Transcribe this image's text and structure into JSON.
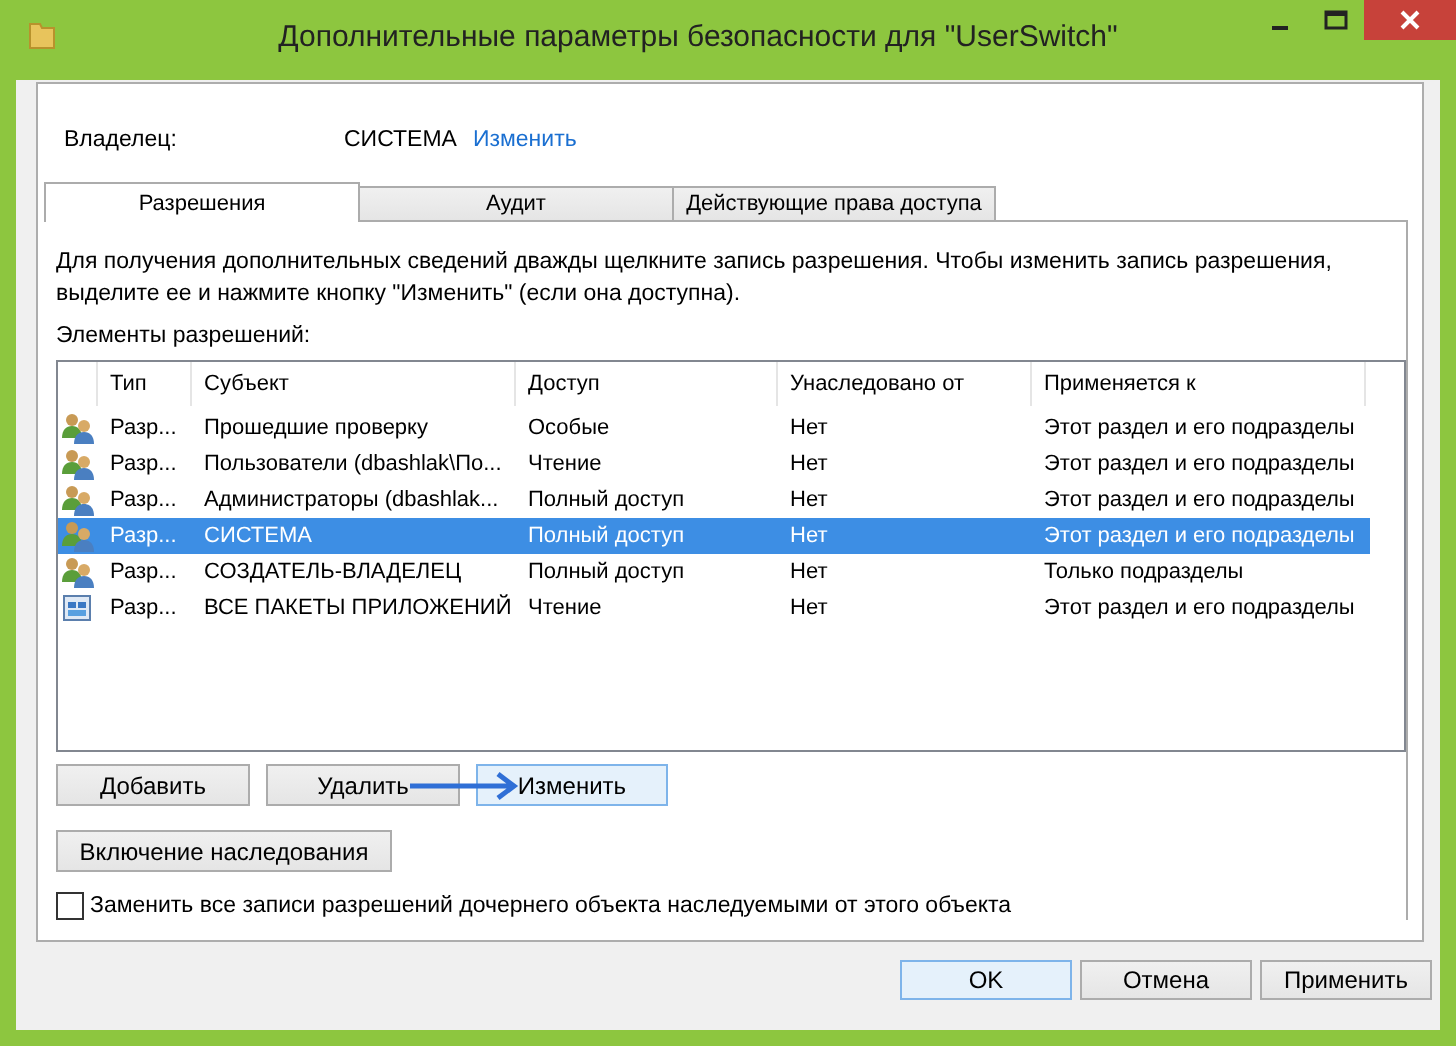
{
  "window": {
    "title": "Дополнительные параметры безопасности  для \"UserSwitch\""
  },
  "owner": {
    "label": "Владелец:",
    "value": "СИСТЕМА",
    "link": "Изменить"
  },
  "tabs": [
    {
      "label": "Разрешения",
      "selected": true
    },
    {
      "label": "Аудит",
      "selected": false
    },
    {
      "label": "Действующие права доступа",
      "selected": false
    }
  ],
  "info": "Для получения дополнительных сведений дважды щелкните запись разрешения. Чтобы изменить запись разрешения, выделите ее и нажмите кнопку \"Изменить\" (если она доступна).",
  "list_label": "Элементы разрешений:",
  "table": {
    "columns": [
      "Тип",
      "Субъект",
      "Доступ",
      "Унаследовано от",
      "Применяется к"
    ],
    "rows": [
      {
        "kind": "group",
        "selected": false,
        "cells": [
          "Разр...",
          "Прошедшие проверку",
          "Особые",
          "Нет",
          "Этот раздел и его подразделы"
        ]
      },
      {
        "kind": "group",
        "selected": false,
        "cells": [
          "Разр...",
          "Пользователи (dbashlak\\По...",
          "Чтение",
          "Нет",
          "Этот раздел и его подразделы"
        ]
      },
      {
        "kind": "group",
        "selected": false,
        "cells": [
          "Разр...",
          "Администраторы (dbashlak...",
          "Полный доступ",
          "Нет",
          "Этот раздел и его подразделы"
        ]
      },
      {
        "kind": "group",
        "selected": true,
        "cells": [
          "Разр...",
          "СИСТЕМА",
          "Полный доступ",
          "Нет",
          "Этот раздел и его подразделы"
        ]
      },
      {
        "kind": "group",
        "selected": false,
        "cells": [
          "Разр...",
          "СОЗДАТЕЛЬ-ВЛАДЕЛЕЦ",
          "Полный доступ",
          "Нет",
          "Только подразделы"
        ]
      },
      {
        "kind": "package",
        "selected": false,
        "cells": [
          "Разр...",
          "ВСЕ ПАКЕТЫ ПРИЛОЖЕНИЙ",
          "Чтение",
          "Нет",
          "Этот раздел и его подразделы"
        ]
      }
    ]
  },
  "entry_buttons": [
    {
      "label": "Добавить",
      "focused": false
    },
    {
      "label": "Удалить",
      "focused": false
    },
    {
      "label": "Изменить",
      "focused": true
    }
  ],
  "inherit_button": "Включение наследования",
  "replace_checkbox": {
    "label": "Заменить все записи разрешений дочернего объекта наследуемыми от этого объекта",
    "checked": false
  },
  "footer_buttons": [
    {
      "label": "OK",
      "default": true
    },
    {
      "label": "Отмена",
      "default": false
    },
    {
      "label": "Применить",
      "default": false
    }
  ]
}
